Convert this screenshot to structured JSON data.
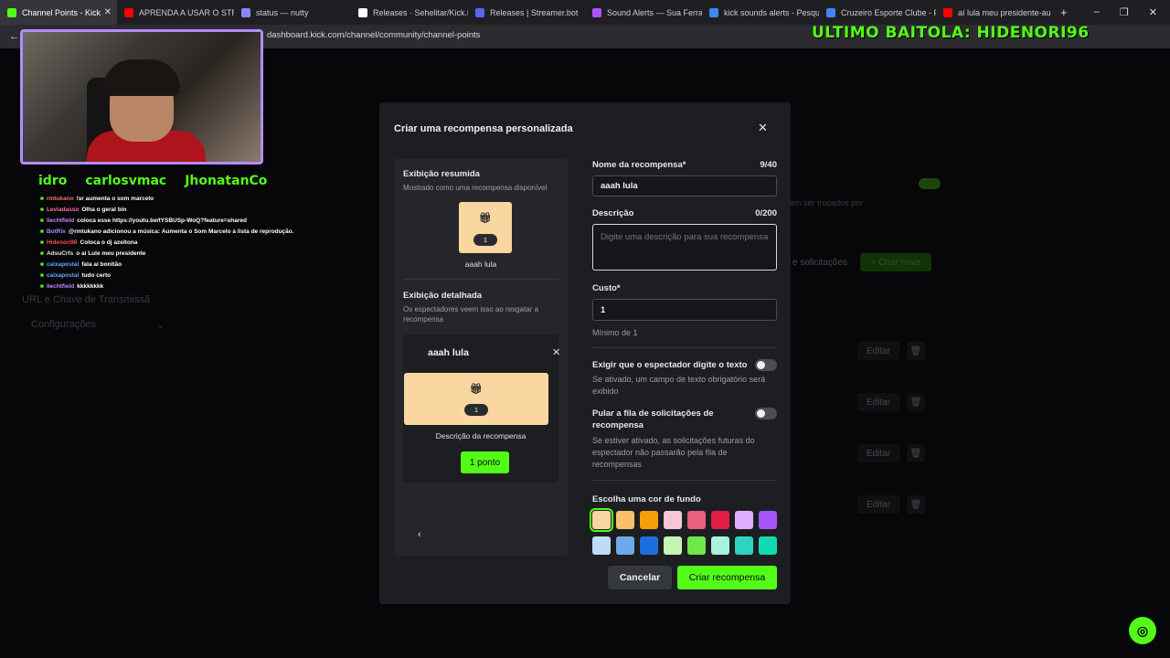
{
  "tabs": [
    {
      "label": "Channel Points - Kick",
      "color": "#53fc18",
      "active": true
    },
    {
      "label": "APRENDA A USAR O STRE",
      "color": "#ff0000"
    },
    {
      "label": "status — nutty",
      "color": "#8888ff"
    },
    {
      "label": "Releases · Sehelitar/Kick.b",
      "color": "#ffffff"
    },
    {
      "label": "Releases | Streamer.bot",
      "color": "#5865f2"
    },
    {
      "label": "Sound Alerts — Sua Ferra",
      "color": "#a855f7"
    },
    {
      "label": "kick sounds alerts - Pesqu",
      "color": "#4285f4"
    },
    {
      "label": "Cruzeiro Esporte Clube - F",
      "color": "#4285f4"
    },
    {
      "label": "aí lula meu presidente-au",
      "color": "#ff0000"
    }
  ],
  "address": {
    "url": "dashboard.kick.com/channel/community/channel-points"
  },
  "overlay": {
    "title": "ULTIMO BAITOLA: HIDENORI96",
    "names": [
      "idro",
      "carlosvmac",
      "JhonatanCo"
    ]
  },
  "chat": [
    {
      "user": "rmtukano",
      "msg": "!sr aumenta o som marcelo",
      "color": "#ff6b6b"
    },
    {
      "user": "Leviadasso",
      "msg": "Olha o geral bin",
      "color": "#ff6b9d"
    },
    {
      "user": "liechtfield",
      "msg": "coloca esse https://youtu.be/tYSBUSp-WoQ?feature=shared",
      "color": "#c084fc"
    },
    {
      "user": "BotRix",
      "msg": "@rmtukano adicionou a música: Aumenta o Som Marcelo à lista de reprodução.",
      "color": "#a78bfa"
    },
    {
      "user": "Hidenori96",
      "msg": "Coloca o dj azeitona",
      "color": "#ff4d4d"
    },
    {
      "user": "AdsuCrfs",
      "msg": "o aí Lule meu presidente",
      "color": "#e5e5e5"
    },
    {
      "user": "caixapostal",
      "msg": "fala aí bonitão",
      "color": "#60a5fa"
    },
    {
      "user": "caixapostal",
      "msg": "tudo certo",
      "color": "#60a5fa"
    },
    {
      "user": "liechtfield",
      "msg": "kkkkkkkk",
      "color": "#c084fc"
    }
  ],
  "background": {
    "sidebar": [
      "URL e Chave de Transmissã",
      "Configurações"
    ],
    "info_text": "em ser trocados por",
    "solicitacoes": "e solicitações",
    "criar_nova": "+ Criar nova",
    "editar": "Editar"
  },
  "modal": {
    "title": "Criar uma recompensa personalizada",
    "preview": {
      "summary_title": "Exibição resumida",
      "summary_sub": "Mostrado como uma recompensa disponível",
      "amount": "1",
      "name": "aaah lula",
      "detail_title": "Exibição detalhada",
      "detail_sub": "Os espectadores veem isso ao resgatar a recompensa",
      "detail_desc": "Descrição da recompensa",
      "points_btn": "1 ponto"
    },
    "form": {
      "name_label": "Nome da recompensa*",
      "name_count": "9/40",
      "name_value": "aaah lula",
      "desc_label": "Descrição",
      "desc_count": "0/200",
      "desc_placeholder": "Digite uma descrição para sua recompensa",
      "cost_label": "Custo*",
      "cost_value": "1",
      "cost_min": "Mínimo de 1",
      "require_text_label": "Exigir que o espectador digite o texto",
      "require_text_help": "Se ativado, um campo de texto obrigatório será exibido",
      "skip_queue_label": "Pular a fila de solicitações de recompensa",
      "skip_queue_help": "Se estiver ativado, as solicitações futuras do espectador não passarão pela fila de recompensas",
      "color_label": "Escolha uma cor de fundo",
      "colors_row1": [
        "#fad7a0",
        "#f9c06b",
        "#f59e0b",
        "#f9c6d4",
        "#e8607f",
        "#e11d48",
        "#e0b0ff",
        "#a855f7"
      ],
      "colors_row2": [
        "#bfdcf5",
        "#6fa8e8",
        "#1d6fe0",
        "#c5f5b5",
        "#6ee74a",
        "#a7f3e0",
        "#2dd4bf",
        "#14d9b0"
      ]
    },
    "cancel": "Cancelar",
    "create": "Criar recompensa"
  }
}
